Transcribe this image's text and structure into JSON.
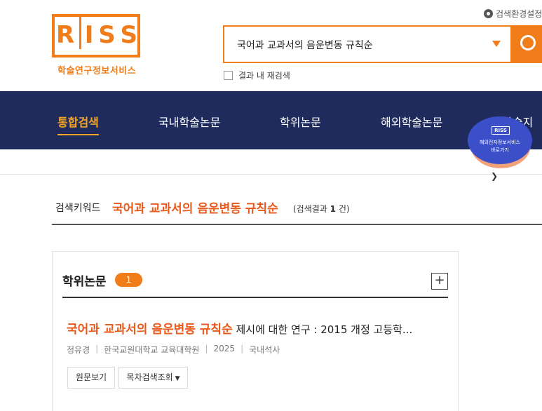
{
  "logo": {
    "letters": [
      "R",
      "I",
      "S",
      "S"
    ],
    "subtitle": "학술연구정보서비스"
  },
  "settings": {
    "label": "검색환경설정"
  },
  "search": {
    "query": "국어과 교과서의 음운변동 규칙순"
  },
  "research": {
    "label": "결과 내 재검색"
  },
  "nav": {
    "items": [
      "통합검색",
      "국내학술논문",
      "학위논문",
      "해외학술논문",
      "학술지"
    ]
  },
  "badge": {
    "logo": "RISS",
    "line1": "해외전자정보서비스",
    "line2": "바로가기"
  },
  "keyword": {
    "label": "검색키워드",
    "value": "국어과 교과서의 음운변동 규칙순",
    "count_prefix": "(검색결과",
    "count": "1",
    "count_suffix": "건)"
  },
  "section": {
    "title": "학위논문",
    "count": "1",
    "expand": "+"
  },
  "result": {
    "title_highlight": "국어과 교과서의 음운변동 규칙순",
    "title_rest": " 제시에 대한 연구 : 2015 개정 고등학...",
    "author": "정유경",
    "institution": "한국교원대학교 교육대학원",
    "year": "2025",
    "type": "국내석사",
    "btn_original": "원문보기",
    "btn_toc": "목차검색조회"
  },
  "colors": {
    "accent": "#f07d1a",
    "nav_bg": "#1e2b5c",
    "highlight": "#e8591a"
  }
}
